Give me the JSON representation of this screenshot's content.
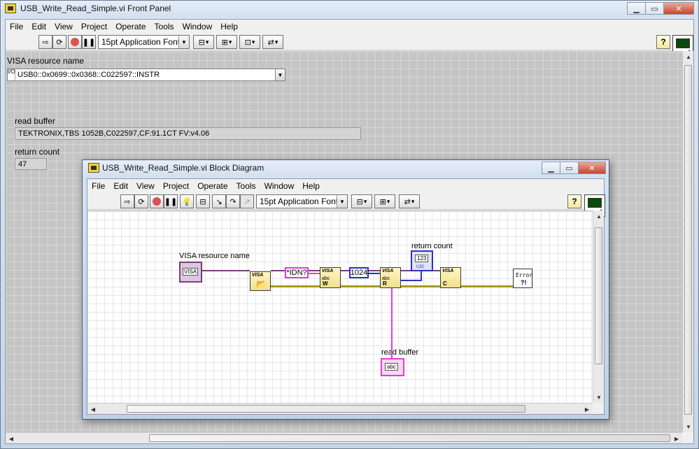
{
  "front_panel": {
    "title": "USB_Write_Read_Simple.vi Front Panel",
    "menu": [
      "File",
      "Edit",
      "View",
      "Project",
      "Operate",
      "Tools",
      "Window",
      "Help"
    ],
    "font_select": "15pt Application Font",
    "help_label": "?",
    "vi_icon_number": "1",
    "controls": {
      "visa_label": "VISA resource name",
      "visa_value": "USB0::0x0699::0x0368::C022597::INSTR",
      "visa_io_glyph": "I/O",
      "read_buffer_label": "read buffer",
      "read_buffer_value": "TEKTRONIX,TBS 1052B,C022597,CF:91.1CT FV:v4.06",
      "return_count_label": "return count",
      "return_count_value": "47"
    }
  },
  "block_diagram": {
    "title": "USB_Write_Read_Simple.vi Block Diagram",
    "menu": [
      "File",
      "Edit",
      "View",
      "Project",
      "Operate",
      "Tools",
      "Window",
      "Help"
    ],
    "font_select": "15pt Application Font",
    "help_label": "?",
    "vi_icon_number": "1",
    "terminals": {
      "visa_label": "VISA resource name",
      "return_count_label": "return count",
      "read_buffer_label": "read buffer",
      "visa_term_text": "VISA",
      "return_count_term_text": "123",
      "return_count_term_type": "U32",
      "read_buffer_term_text": "abc"
    },
    "constants": {
      "idn": "*IDN?",
      "byte_count": "1024"
    },
    "nodes": {
      "open": "VISA",
      "write": "VISA",
      "read": "VISA",
      "close": "VISA",
      "error": "Error"
    }
  },
  "colors": {
    "visa_wire": "#7a3d7a",
    "error_wire": "#a79a1e",
    "string_wire": "#e040c8",
    "integer_wire": "#3030c0"
  }
}
